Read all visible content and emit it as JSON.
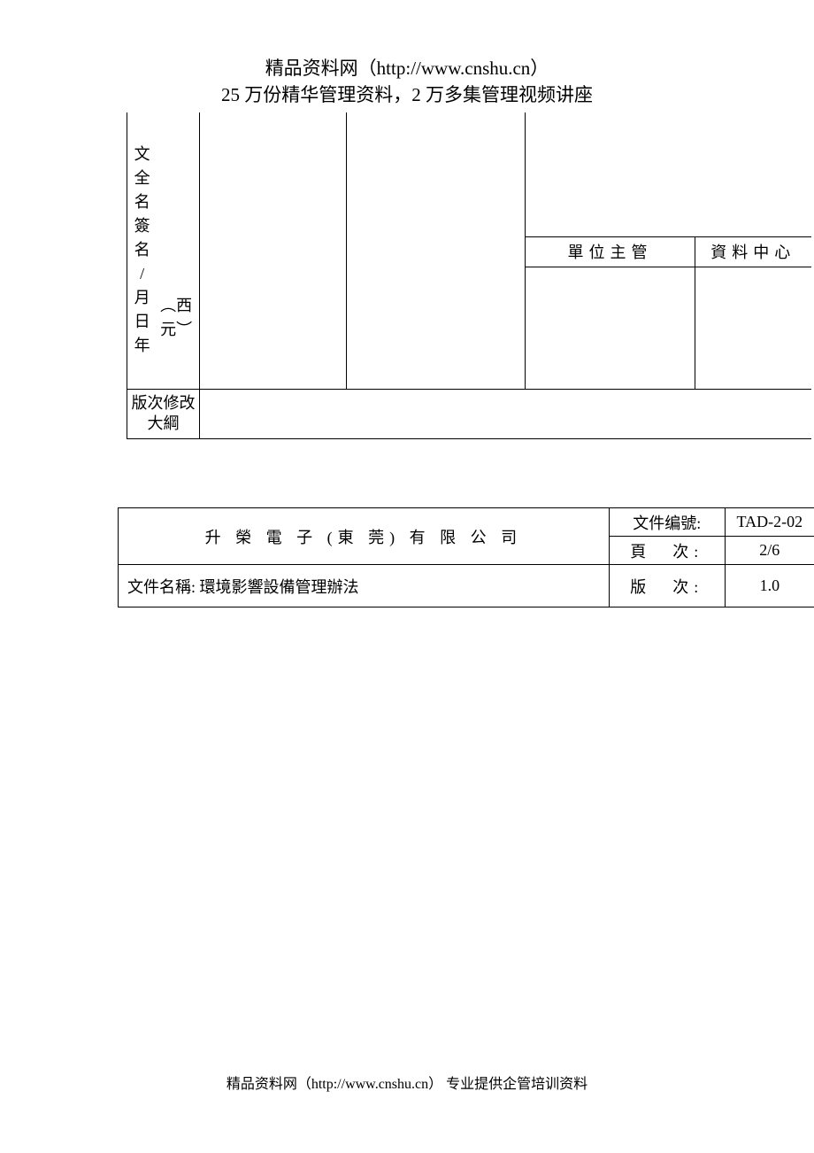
{
  "header": {
    "line1": "精品资料网（http://www.cnshu.cn）",
    "line2": "25 万份精华管理资料，2 万多集管理视频讲座"
  },
  "table1": {
    "col1_text": "文全名簽名/月日年",
    "col1_side": "︵西元︶",
    "sub_label1": "單位主管",
    "sub_label2": "資料中心",
    "outline_label": "版次修改大綱"
  },
  "table2": {
    "company": "升 榮 電 子 (東 莞) 有 限 公 司",
    "rows": {
      "docno_label": "文件编號:",
      "docno_val": "TAD-2-02",
      "page_label": "頁　次:",
      "page_val": "2/6",
      "docname_label": "文件名稱:",
      "docname_val": "環境影響設備管理辦法",
      "ver_label": "版　次:",
      "ver_val": "1.0"
    }
  },
  "footer": "精品资料网（http://www.cnshu.cn）  专业提供企管培训资料"
}
